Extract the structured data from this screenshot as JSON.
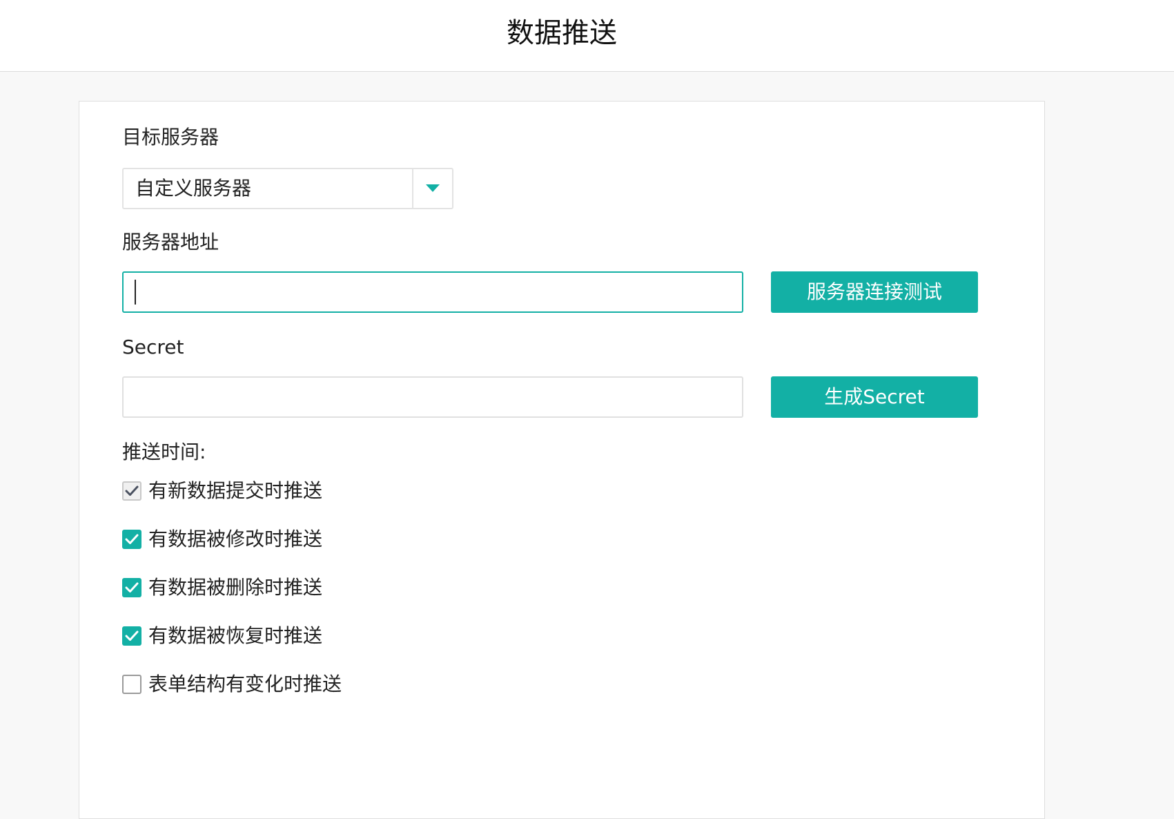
{
  "header": {
    "title": "数据推送"
  },
  "form": {
    "target_server": {
      "label": "目标服务器",
      "selected": "自定义服务器"
    },
    "server_address": {
      "label": "服务器地址",
      "value": "",
      "test_button": "服务器连接测试"
    },
    "secret": {
      "label": "Secret",
      "value": "",
      "generate_button": "生成Secret"
    },
    "push_time": {
      "label": "推送时间:",
      "options": [
        {
          "label": "有新数据提交时推送",
          "checked": true,
          "disabled": true
        },
        {
          "label": "有数据被修改时推送",
          "checked": true,
          "disabled": false
        },
        {
          "label": "有数据被删除时推送",
          "checked": true,
          "disabled": false
        },
        {
          "label": "有数据被恢复时推送",
          "checked": true,
          "disabled": false
        },
        {
          "label": "表单结构有变化时推送",
          "checked": false,
          "disabled": false
        }
      ]
    }
  },
  "colors": {
    "accent": "#13b0a5",
    "page_background": "#f8f8f8",
    "card_background": "#ffffff"
  },
  "icons": {
    "dropdown": "caret-down-icon",
    "check": "check-icon"
  }
}
